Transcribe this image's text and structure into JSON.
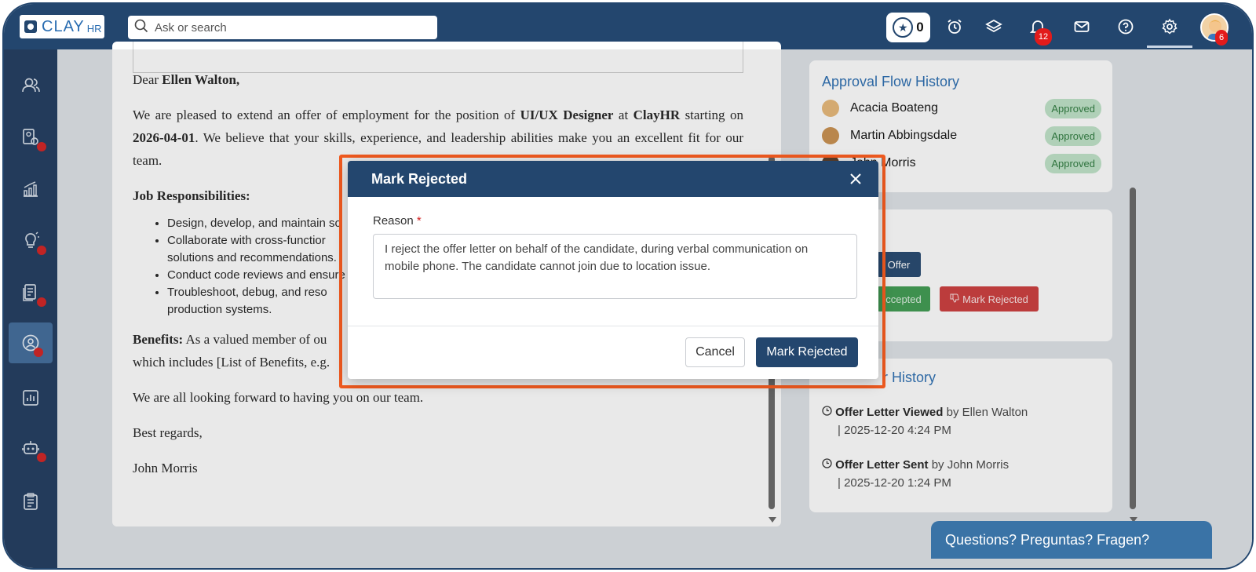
{
  "app": {
    "logo_text": "CLAY",
    "logo_suffix": "HR"
  },
  "search": {
    "placeholder": "Ask or search"
  },
  "topbar": {
    "star_count": "0",
    "notification_count": "12",
    "avatar_badge": "6",
    "icons": [
      "star-icon",
      "alarm-clock-icon",
      "layers-icon",
      "bell-icon",
      "mail-icon",
      "help-icon",
      "gear-icon"
    ]
  },
  "sidebar": {
    "items": [
      {
        "icon": "people-icon",
        "dot": false
      },
      {
        "icon": "candidate-search-icon",
        "dot": true
      },
      {
        "icon": "chart-bars-icon",
        "dot": false
      },
      {
        "icon": "idea-icon",
        "dot": true
      },
      {
        "icon": "documents-icon",
        "dot": true
      },
      {
        "icon": "user-circle-icon",
        "dot": true,
        "active": true
      },
      {
        "icon": "report-icon",
        "dot": false
      },
      {
        "icon": "bot-icon",
        "dot": true
      },
      {
        "icon": "clipboard-icon",
        "dot": false
      }
    ]
  },
  "letter": {
    "greeting_prefix": "Dear ",
    "candidate_name": "Ellen Walton,",
    "p1_a": "We are pleased to extend an offer of employment for the position of ",
    "position": "UI/UX Designer",
    "p1_b": " at ",
    "company": "ClayHR",
    "p1_c": " starting on ",
    "start_date": "2026-04-01",
    "p1_d": ". We believe that your skills, experience, and leadership abilities make you an excellent fit for our team.",
    "responsibilities_heading": "Job Responsibilities:",
    "responsibilities": [
      "Design, develop, and maintain so",
      "Collaborate with cross-functior",
      "solutions and recommendations.",
      "Conduct code reviews and ensure",
      "Troubleshoot, debug, and reso",
      "production systems."
    ],
    "benefits_label": "Benefits:",
    "benefits_text_1": " As a valued member of ou",
    "benefits_text_2": "which includes [List of Benefits, e.g. ",
    "closing_line": "We are all looking forward to having you on our team.",
    "sign_off": "Best regards,",
    "signer": "John Morris"
  },
  "approval_flow": {
    "title": "Approval Flow History",
    "rows": [
      {
        "name": "Acacia Boateng",
        "status": "Approved"
      },
      {
        "name": "Martin Abbingsdale",
        "status": "Approved"
      },
      {
        "name": "John Morris",
        "status": "Approved"
      }
    ]
  },
  "actions": {
    "offer_btn": "Offer",
    "accepted_btn": "ccepted",
    "rejected_btn": "Mark Rejected"
  },
  "offer_history": {
    "title": "r History",
    "events": [
      {
        "event": "Offer Letter Viewed",
        "by": " by Ellen Walton",
        "when": "| 2025-12-20  4:24 PM"
      },
      {
        "event": "Offer Letter Sent",
        "by": " by John Morris",
        "when": "| 2025-12-20  1:24 PM"
      }
    ]
  },
  "help_bar": {
    "text": "Questions? Preguntas? Fragen?"
  },
  "modal": {
    "title": "Mark Rejected",
    "reason_label": "Reason",
    "required_mark": "*",
    "reason_value": "I reject the offer letter on behalf of the candidate, during verbal communication on mobile phone. The candidate cannot join due to location issue.",
    "cancel_label": "Cancel",
    "confirm_label": "Mark Rejected"
  },
  "colors": {
    "primary": "#23466e",
    "accent_orange": "#f05a1f",
    "approved_bg": "#bfe3c8",
    "danger": "#cc3b3b"
  }
}
